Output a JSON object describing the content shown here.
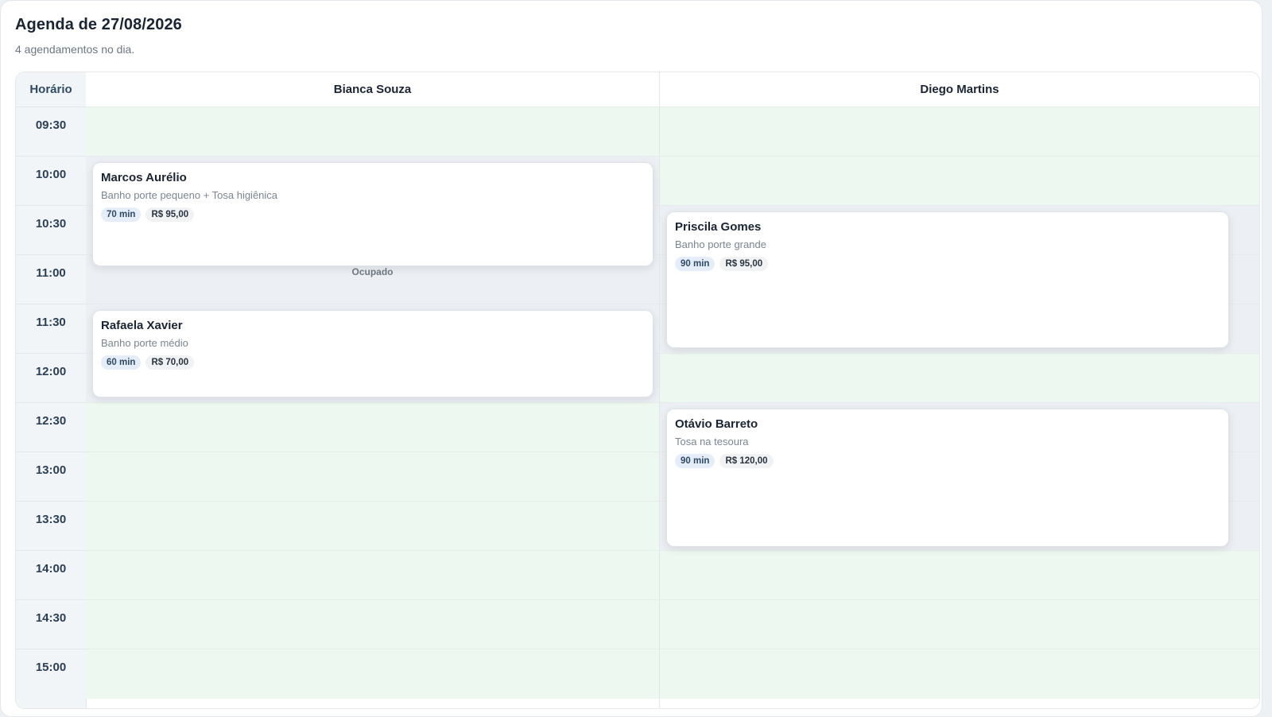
{
  "header": {
    "title": "Agenda de 27/08/2026",
    "subtitle": "4 agendamentos no dia."
  },
  "grid": {
    "time_header": "Horário",
    "times": [
      "09:30",
      "10:00",
      "10:30",
      "11:00",
      "11:30",
      "12:00",
      "12:30",
      "13:00",
      "13:30",
      "14:00",
      "14:30",
      "15:00"
    ],
    "staff": [
      {
        "name": "Bianca Souza",
        "busy_label": "Ocupado",
        "appointments": [
          {
            "client": "Marcos Aurélio",
            "service": "Banho porte pequeno + Tosa higiênica",
            "duration": "70 min",
            "price": "R$ 95,00"
          },
          {
            "client": "Rafaela Xavier",
            "service": "Banho porte médio",
            "duration": "60 min",
            "price": "R$ 70,00"
          }
        ]
      },
      {
        "name": "Diego Martins",
        "appointments": [
          {
            "client": "Priscila Gomes",
            "service": "Banho porte grande",
            "duration": "90 min",
            "price": "R$ 95,00"
          },
          {
            "client": "Otávio Barreto",
            "service": "Tosa na tesoura",
            "duration": "90 min",
            "price": "R$ 120,00"
          }
        ]
      }
    ]
  },
  "colors": {
    "free_slot": "#edf8f0",
    "busy_slot": "#eceff3",
    "time_column": "#f2f5f8",
    "duration_tag": "#e5eef8"
  }
}
